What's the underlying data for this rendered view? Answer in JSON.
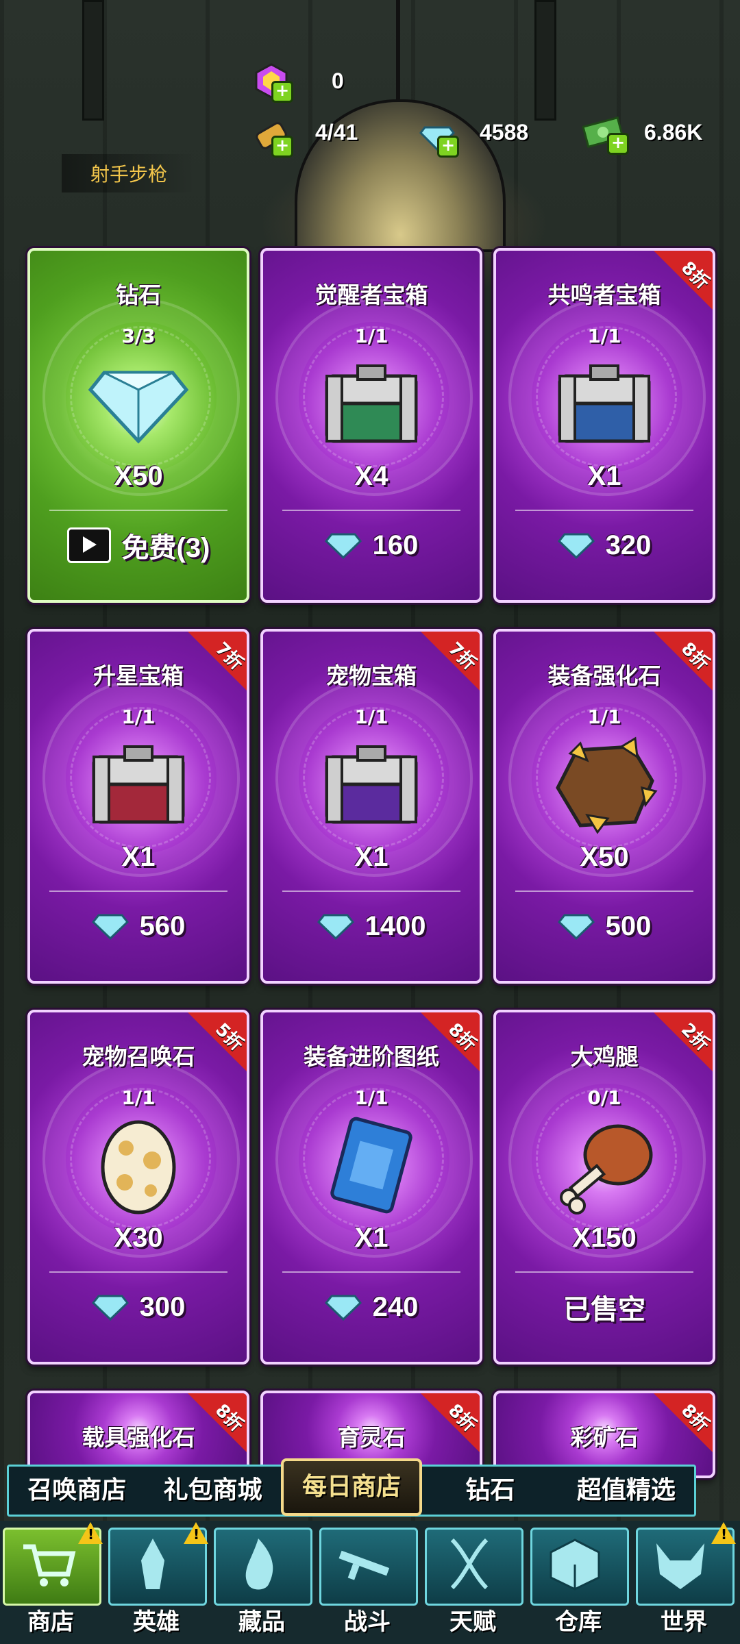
{
  "currencies": {
    "tickets": "0",
    "stamina": "4/41",
    "diamonds": "4588",
    "cash": "6.86K"
  },
  "weapon_label": "射手步枪",
  "cards": [
    {
      "title": "钻石",
      "limit": "3/3",
      "qty": "X50",
      "price": "免费(3)",
      "price_type": "ad",
      "discount": ""
    },
    {
      "title": "觉醒者宝箱",
      "limit": "1/1",
      "qty": "X4",
      "price": "160",
      "price_type": "gem",
      "discount": ""
    },
    {
      "title": "共鸣者宝箱",
      "limit": "1/1",
      "qty": "X1",
      "price": "320",
      "price_type": "gem",
      "discount": "8折"
    },
    {
      "title": "升星宝箱",
      "limit": "1/1",
      "qty": "X1",
      "price": "560",
      "price_type": "gem",
      "discount": "7折"
    },
    {
      "title": "宠物宝箱",
      "limit": "1/1",
      "qty": "X1",
      "price": "1400",
      "price_type": "gem",
      "discount": "7折"
    },
    {
      "title": "装备强化石",
      "limit": "1/1",
      "qty": "X50",
      "price": "500",
      "price_type": "gem",
      "discount": "8折"
    },
    {
      "title": "宠物召唤石",
      "limit": "1/1",
      "qty": "X30",
      "price": "300",
      "price_type": "gem",
      "discount": "5折"
    },
    {
      "title": "装备进阶图纸",
      "limit": "1/1",
      "qty": "X1",
      "price": "240",
      "price_type": "gem",
      "discount": "8折"
    },
    {
      "title": "大鸡腿",
      "limit": "0/1",
      "qty": "X150",
      "price": "已售空",
      "price_type": "soldout",
      "discount": "2折"
    },
    {
      "title": "载具强化石",
      "discount": "8折"
    },
    {
      "title": "育灵石",
      "discount": "8折"
    },
    {
      "title": "彩矿石",
      "discount": "8折"
    }
  ],
  "tabs": [
    "召唤商店",
    "礼包商城",
    "每日商店",
    "钻石",
    "超值精选"
  ],
  "active_tab": "每日商店",
  "nav": [
    "商店",
    "英雄",
    "藏品",
    "战斗",
    "天赋",
    "仓库",
    "世界"
  ],
  "warning_mark": "!",
  "plus_mark": "+",
  "colors": {
    "card_purple": "#8a22b8",
    "card_green": "#5fae2a",
    "discount_red": "#d42424",
    "tab_gold": "#f5d98a"
  }
}
